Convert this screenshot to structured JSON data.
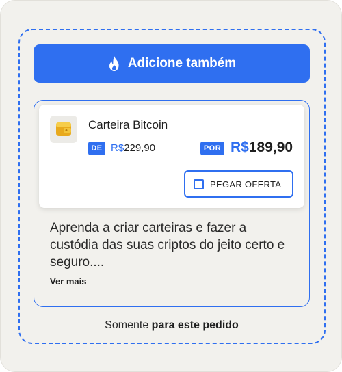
{
  "upsell": {
    "cta_label": "Adicione também",
    "cta_icon": "flame-icon",
    "accent_color": "#2f6ff0",
    "product": {
      "icon": "wallet-icon",
      "name": "Carteira Bitcoin",
      "from_badge": "DE",
      "old_currency": "R$",
      "old_price": "229,90",
      "to_badge": "POR",
      "new_currency": "R$",
      "new_price": "189,90",
      "offer_button": "PEGAR OFERTA",
      "offer_checked": false
    },
    "description": "Aprenda a criar carteiras e fazer a custódia das suas criptos do jeito certo e seguro....",
    "see_more": "Ver mais",
    "footer": {
      "prefix": "Somente",
      "emphasis": "para este pedido"
    }
  }
}
